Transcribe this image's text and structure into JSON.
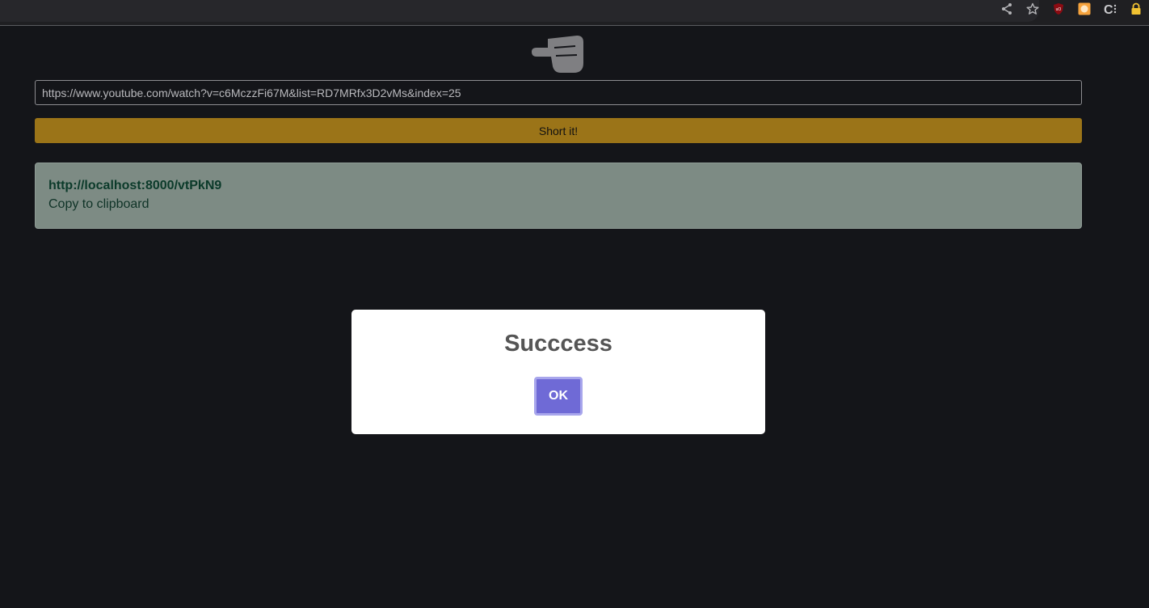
{
  "browser": {
    "toolbar_icons": [
      "share-icon",
      "star-icon",
      "ublock-icon",
      "extension-icon",
      "c-extension-icon",
      "lock-icon"
    ]
  },
  "logo": {
    "icon": "pointing-hand-icon"
  },
  "form": {
    "url_value": "https://www.youtube.com/watch?v=c6MczzFi67M&list=RD7MRfx3D2vMs&index=25",
    "submit_label": "Short it!"
  },
  "result": {
    "short_url": "http://localhost:8000/vtPkN9",
    "copy_label": "Copy to clipboard"
  },
  "modal": {
    "title": "Succcess",
    "ok_label": "OK"
  },
  "colors": {
    "background": "#141519",
    "submit_button": "#9b7418",
    "result_box": "#7d8b84",
    "ok_button": "#6f6ad6"
  }
}
